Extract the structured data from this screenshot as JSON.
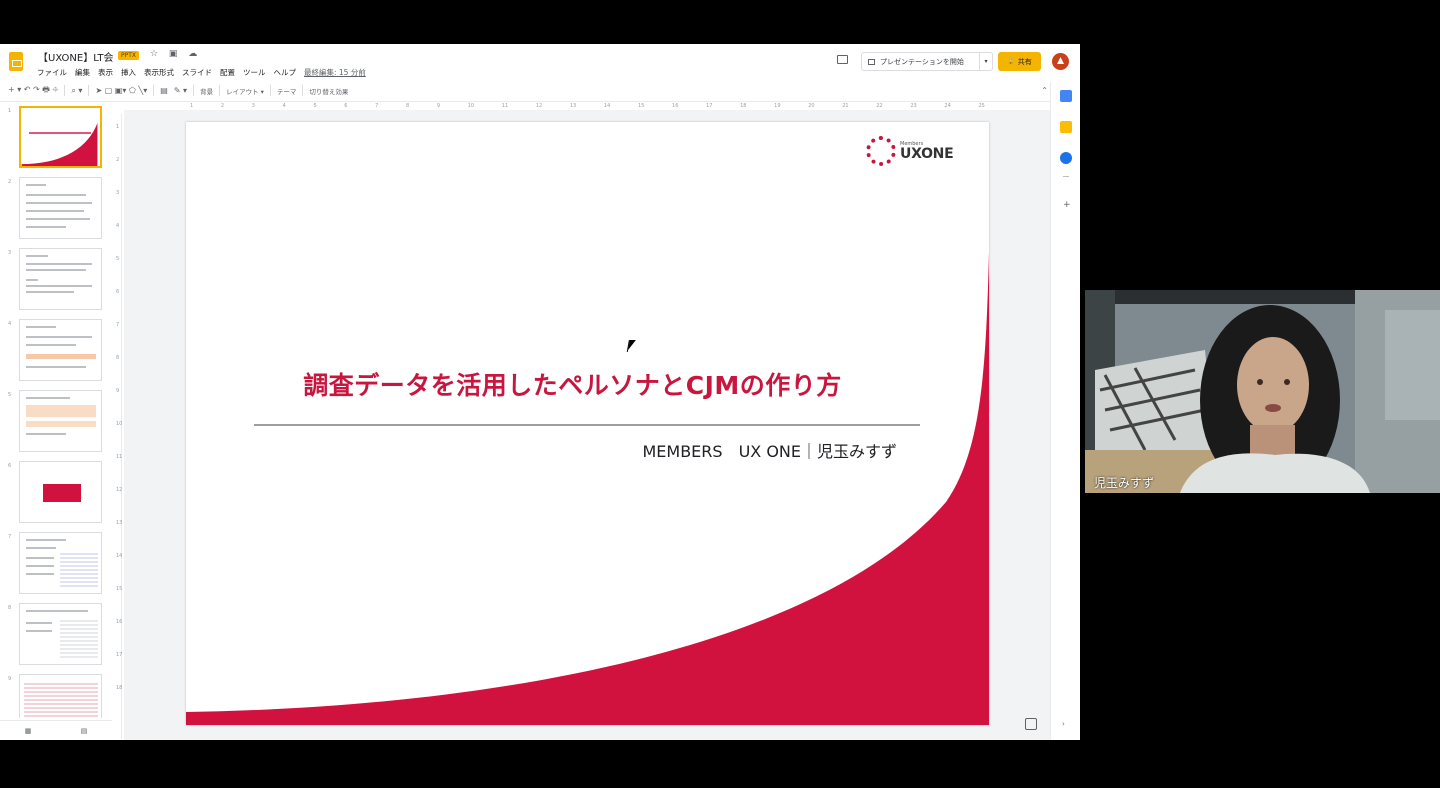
{
  "app": {
    "doc_title": "【UXONE】LT会",
    "file_badge": "PPTX",
    "title_icons": "☆ ▣ ☁"
  },
  "menu": {
    "items": [
      "ファイル",
      "編集",
      "表示",
      "挿入",
      "表示形式",
      "スライド",
      "配置",
      "ツール",
      "ヘルプ"
    ],
    "last_edit": "最終編集: 15 分前"
  },
  "header": {
    "present_label": "プレゼンテーションを開始",
    "present_caret": "▾",
    "share_icon": "🔒",
    "share_label": "共有"
  },
  "toolbar": {
    "icons_left": "+ ▾ ↶ ↷ 🖶 ⌖",
    "zoom": "⌕ ▾",
    "tools": "➤ ▢ ▣▾ ⬠ ╲▾",
    "comment": "▤",
    "pen": "✎ ▾",
    "background": "背景",
    "layout": "レイアウト ▾",
    "theme": "テーマ",
    "transition": "切り替え効果",
    "collapse": "⌃"
  },
  "ruler": {
    "ticks": [
      "1",
      "2",
      "3",
      "4",
      "5",
      "6",
      "7",
      "8",
      "9",
      "10",
      "11",
      "12",
      "13",
      "14",
      "15",
      "16",
      "17",
      "18",
      "19",
      "20",
      "21",
      "22",
      "23",
      "24",
      "25"
    ]
  },
  "v_ruler": {
    "ticks": [
      "1",
      "2",
      "3",
      "4",
      "5",
      "6",
      "7",
      "8",
      "9",
      "10",
      "11",
      "12",
      "13",
      "14",
      "15",
      "16",
      "17",
      "18"
    ]
  },
  "filmstrip": {
    "numbers": [
      "1",
      "2",
      "3",
      "4",
      "5",
      "6",
      "7",
      "8",
      "9"
    ],
    "bottom_left": "▦",
    "bottom_right": "▤"
  },
  "slide": {
    "title": "調査データを活用したペルソナとCJMの作り方",
    "subtitle": "MEMBERS　UX ONE｜児玉みすず",
    "logo_small": "Members",
    "logo_big": "UXONE",
    "accent_color": "#d1123f"
  },
  "video": {
    "participant_name": "児玉みすず"
  }
}
